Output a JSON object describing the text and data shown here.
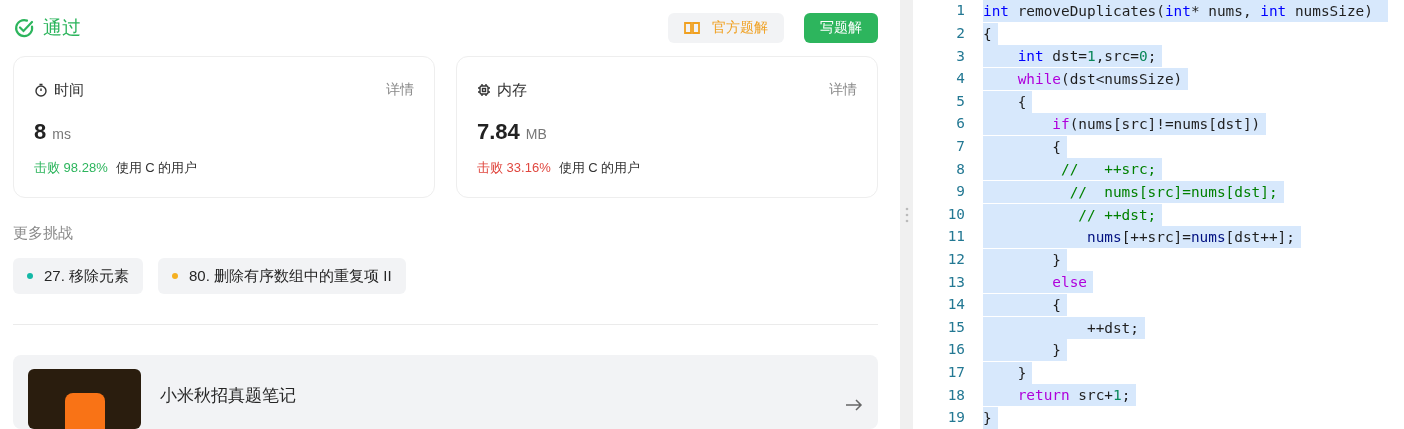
{
  "result": {
    "status": "通过",
    "buttons": [
      {
        "kind": "secondary",
        "label": "官方题解"
      },
      {
        "kind": "primary",
        "label": "写题解"
      }
    ]
  },
  "stats": [
    {
      "kind": "time",
      "title": "时间",
      "detail": "详情",
      "value": "8",
      "unit": "ms",
      "beat": "击败 98.28%",
      "beat_good": true,
      "suffix": "使用 C 的用户"
    },
    {
      "kind": "memory",
      "title": "内存",
      "detail": "详情",
      "value": "7.84",
      "unit": "MB",
      "beat": "击败 33.16%",
      "beat_good": false,
      "suffix": "使用 C 的用户"
    }
  ],
  "more": {
    "title": "更多挑战",
    "items": [
      {
        "label": "27. 移除元素",
        "color": "#14b8a6"
      },
      {
        "label": "80. 删除有序数组中的重复项 II",
        "color": "#f5b021"
      }
    ]
  },
  "promo": {
    "title": "小米秋招真题笔记"
  },
  "code": {
    "lines": [
      {
        "number": "1",
        "tokens": [
          {
            "kind": "keyword",
            "text": "int"
          },
          {
            "kind": "plain",
            "text": " removeDuplicates("
          },
          {
            "kind": "keyword",
            "text": "int"
          },
          {
            "kind": "plain",
            "text": "* nums, "
          },
          {
            "kind": "keyword",
            "text": "int"
          },
          {
            "kind": "plain",
            "text": " numsSize) "
          }
        ]
      },
      {
        "number": "2",
        "tokens": [
          {
            "kind": "plain",
            "text": "{"
          }
        ]
      },
      {
        "number": "3",
        "tokens": [
          {
            "kind": "keyword",
            "text": "    int"
          },
          {
            "kind": "plain",
            "text": " dst="
          },
          {
            "kind": "number",
            "text": "1"
          },
          {
            "kind": "plain",
            "text": ",src="
          },
          {
            "kind": "number",
            "text": "0"
          },
          {
            "kind": "plain",
            "text": ";"
          }
        ]
      },
      {
        "number": "4",
        "tokens": [
          {
            "kind": "control",
            "text": "    while"
          },
          {
            "kind": "plain",
            "text": "(dst<numsSize)"
          }
        ]
      },
      {
        "number": "5",
        "tokens": [
          {
            "kind": "plain",
            "text": "    {"
          }
        ]
      },
      {
        "number": "6",
        "tokens": [
          {
            "kind": "control",
            "text": "        if"
          },
          {
            "kind": "plain",
            "text": "(nums[src]!=nums[dst])"
          }
        ]
      },
      {
        "number": "7",
        "tokens": [
          {
            "kind": "plain",
            "text": "        {"
          }
        ]
      },
      {
        "number": "8",
        "tokens": [
          {
            "kind": "comment",
            "text": "         //   ++src;"
          }
        ]
      },
      {
        "number": "9",
        "tokens": [
          {
            "kind": "comment",
            "text": "          //  nums[src]=nums[dst];"
          }
        ]
      },
      {
        "number": "10",
        "tokens": [
          {
            "kind": "comment",
            "text": "           // ++dst;"
          }
        ]
      },
      {
        "number": "11",
        "tokens": [
          {
            "kind": "variable",
            "text": "            nums"
          },
          {
            "kind": "plain",
            "text": "[++src]="
          },
          {
            "kind": "variable",
            "text": "nums"
          },
          {
            "kind": "plain",
            "text": "[dst++];"
          }
        ]
      },
      {
        "number": "12",
        "tokens": [
          {
            "kind": "plain",
            "text": "        }"
          }
        ]
      },
      {
        "number": "13",
        "tokens": [
          {
            "kind": "control",
            "text": "        else"
          }
        ]
      },
      {
        "number": "14",
        "tokens": [
          {
            "kind": "plain",
            "text": "        {"
          }
        ]
      },
      {
        "number": "15",
        "tokens": [
          {
            "kind": "plain",
            "text": "            ++dst;"
          }
        ]
      },
      {
        "number": "16",
        "tokens": [
          {
            "kind": "plain",
            "text": "        }"
          }
        ]
      },
      {
        "number": "17",
        "tokens": [
          {
            "kind": "plain",
            "text": "    }"
          }
        ]
      },
      {
        "number": "18",
        "tokens": [
          {
            "kind": "control",
            "text": "    return"
          },
          {
            "kind": "plain",
            "text": " src+"
          },
          {
            "kind": "number",
            "text": "1"
          },
          {
            "kind": "plain",
            "text": ";"
          }
        ]
      },
      {
        "number": "19",
        "tokens": [
          {
            "kind": "plain",
            "text": "}"
          }
        ]
      }
    ]
  }
}
